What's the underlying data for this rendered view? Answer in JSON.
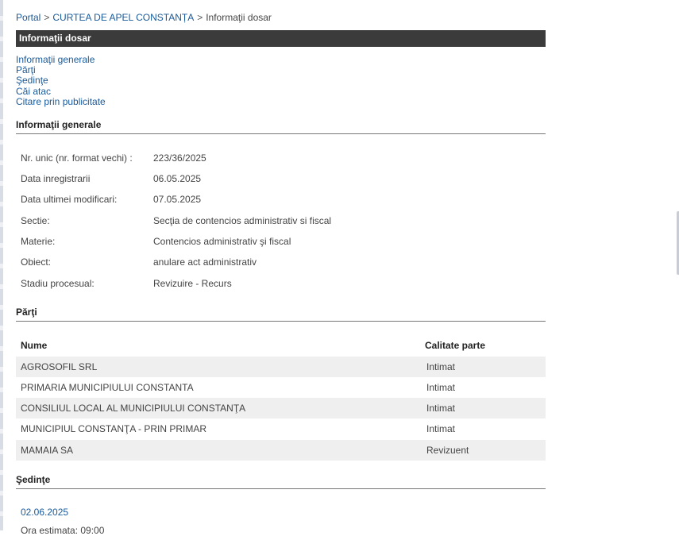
{
  "breadcrumb": {
    "portal": "Portal",
    "court": "CURTEA DE APEL CONSTANȚA",
    "current": "Informaţii dosar",
    "separator": ">"
  },
  "page_title": "Informaţii dosar",
  "toc": [
    "Informaţii generale",
    "Părţi",
    "Şedinţe",
    "Căi atac",
    "Citare prin publicitate"
  ],
  "sections": {
    "general": "Informaţii generale",
    "parti": "Părţi",
    "sedinte": "Şedinţe"
  },
  "general_info": [
    {
      "label": "Nr. unic (nr. format vechi) :",
      "value": "223/36/2025"
    },
    {
      "label": "Data inregistrarii",
      "value": "06.05.2025"
    },
    {
      "label": "Data ultimei modificari:",
      "value": "07.05.2025"
    },
    {
      "label": "Sectie:",
      "value": "Secţia de contencios administrativ si fiscal"
    },
    {
      "label": "Materie:",
      "value": "Contencios administrativ şi fiscal"
    },
    {
      "label": "Obiect:",
      "value": "anulare act administrativ"
    },
    {
      "label": "Stadiu procesual:",
      "value": "Revizuire - Recurs"
    }
  ],
  "parti": {
    "headers": {
      "name": "Nume",
      "role": "Calitate parte"
    },
    "rows": [
      {
        "name": "AGROSOFIL SRL",
        "role": "Intimat"
      },
      {
        "name": "PRIMARIA MUNICIPIULUI CONSTANTA",
        "role": "Intimat"
      },
      {
        "name": "CONSILIUL LOCAL AL MUNICIPIULUI CONSTANŢA",
        "role": "Intimat"
      },
      {
        "name": "MUNICIPIUL CONSTANŢA - PRIN PRIMAR",
        "role": "Intimat"
      },
      {
        "name": "MAMAIA SA",
        "role": "Revizuent"
      }
    ]
  },
  "sedinte": {
    "date": "02.06.2025",
    "next_line": "Ora estimata: 09:00"
  },
  "colors": {
    "link": "#1a5a9a",
    "titlebar": "#3b3b3b",
    "row_alt": "#efefef"
  }
}
